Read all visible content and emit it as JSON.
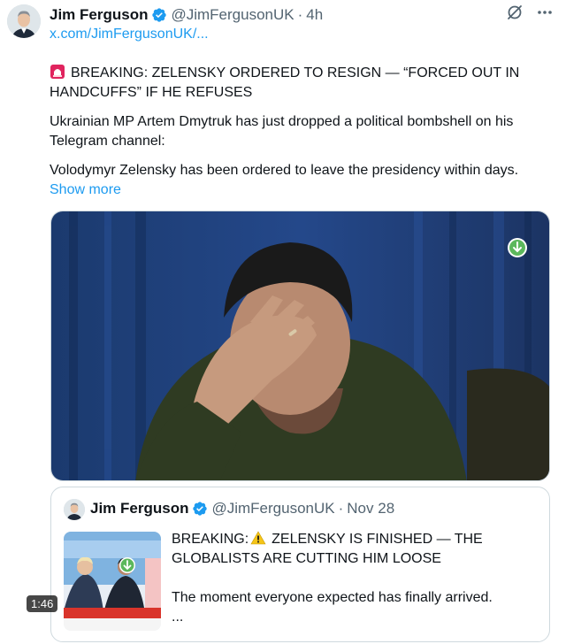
{
  "tweet": {
    "author_name": "Jim Ferguson",
    "author_handle": "@JimFergusonUK",
    "separator": "·",
    "time": "4h",
    "link": "x.com/JimFergusonUK/...",
    "headline": "BREAKING: ZELENSKY ORDERED TO RESIGN — “FORCED OUT IN HANDCUFFS” IF HE REFUSES",
    "paragraph_2": "Ukrainian MP Artem Dmytruk has just dropped a political bombshell on his Telegram channel:",
    "paragraph_3": "Volodymyr Zelensky has been ordered to leave the presidency within days.",
    "show_more": "Show more",
    "media_icon": "download-badge-icon"
  },
  "quote": {
    "author_name": "Jim Ferguson",
    "author_handle": "@JimFergusonUK",
    "separator": "·",
    "time": "Nov 28",
    "headline_prefix": "BREAKING:",
    "headline_rest": "ZELENSKY IS FINISHED — THE GLOBALISTS ARE CUTTING HIM LOOSE",
    "body": "The moment everyone expected has finally arrived.",
    "ellipsis": "...",
    "video_duration": "1:46"
  },
  "icons": {
    "verified": "verified-badge-icon",
    "grok": "grok-icon",
    "more": "more-icon",
    "siren": "siren-icon",
    "warning": "warning-icon"
  },
  "colors": {
    "link_blue": "#1d9bf0",
    "muted": "#536471",
    "verified_blue": "#1d9bf0",
    "siren_red": "#e0245e",
    "warning_yellow": "#f5c518"
  }
}
